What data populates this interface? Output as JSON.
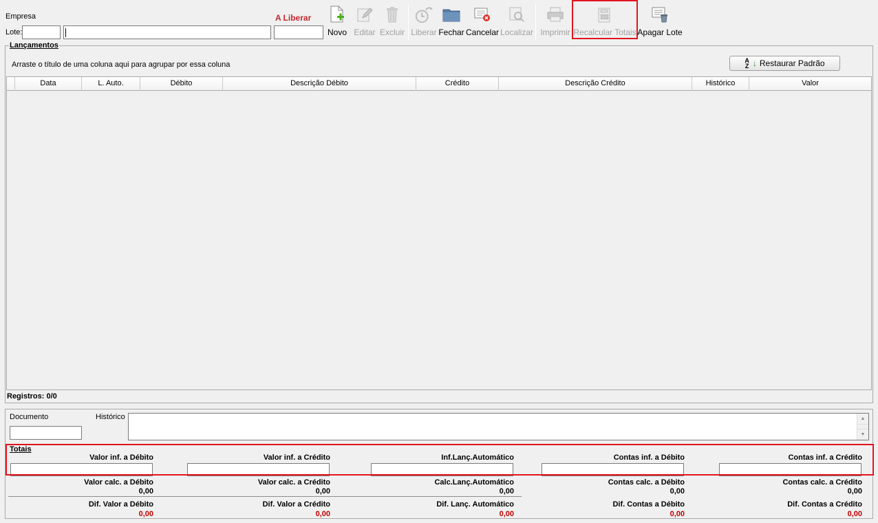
{
  "header": {
    "empresa_label": "Empresa",
    "lote_label": "Lote:",
    "lote_value": "",
    "lote_desc_value": "",
    "status_label": "A Liberar",
    "status_value": ""
  },
  "toolbar": {
    "novo": "Novo",
    "editar": "Editar",
    "excluir": "Excluir",
    "liberar": "Liberar",
    "fechar": "Fechar",
    "cancelar": "Cancelar",
    "localizar": "Localizar",
    "imprimir": "Imprimir",
    "recalcular": "Recalcular Totais",
    "apagar": "Apagar Lote"
  },
  "lancamentos": {
    "title": "Lançamentos",
    "group_hint": "Arraste o título de uma coluna aqui para agrupar por essa coluna",
    "restore_button": "Restaurar Padrão",
    "columns": [
      "Data",
      "L. Auto.",
      "Débito",
      "Descrição Débito",
      "Crédito",
      "Descrição Crédito",
      "Histórico",
      "Valor"
    ],
    "records": "Registros: 0/0"
  },
  "detail": {
    "documento_label": "Documento",
    "documento_value": "",
    "historico_label": "Histórico",
    "historico_value": ""
  },
  "totais": {
    "title": "Totais",
    "inf_labels": [
      "Valor inf. a Débito",
      "Valor inf. a Crédito",
      "Inf.Lanç.Automático",
      "Contas inf. a Débito",
      "Contas inf. a Crédito"
    ],
    "calc_labels": [
      "Valor calc. a Débito",
      "Valor calc. a Crédito",
      "Calc.Lanç.Automático",
      "Contas calc. a Débito",
      "Contas calc. a Crédito"
    ],
    "calc_values": [
      "0,00",
      "0,00",
      "0,00",
      "0,00",
      "0,00"
    ],
    "dif_labels": [
      "Dif. Valor a Débito",
      "Dif. Valor a Crédito",
      "Dif. Lanç. Automático",
      "Dif. Contas a Débito",
      "Dif. Contas a Crédito"
    ],
    "dif_values": [
      "0,00",
      "0,00",
      "0,00",
      "0,00",
      "0,00"
    ]
  },
  "colors": {
    "accent_red": "#c00000",
    "highlight_red": "#e0141e"
  }
}
